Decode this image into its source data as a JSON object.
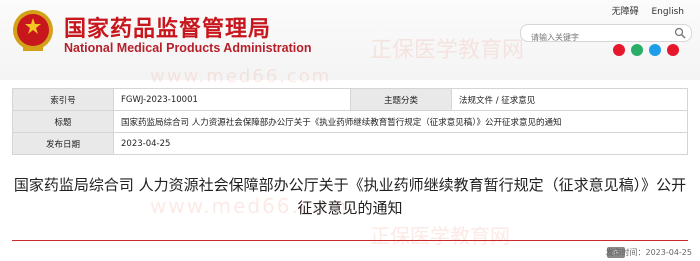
{
  "header": {
    "site_title_cn": "国家药品监督管理局",
    "site_title_en": "National Medical Products Administration",
    "top_links": [
      "无障碍",
      "English"
    ],
    "search_placeholder": "请输入关键字"
  },
  "watermark": {
    "brand": "正保医学教育网",
    "url": "www.med66.com"
  },
  "meta": {
    "index_label": "索引号",
    "index_value": "FGWJ-2023-10001",
    "subject_label": "主题分类",
    "subject_value": "法规文件 / 征求意见",
    "title_label": "标题",
    "title_value": "国家药监局综合司 人力资源社会保障部办公厅关于《执业药师继续教育暂行规定（征求意见稿）》公开征求意见的通知",
    "date_label": "发布日期",
    "date_value": "2023-04-25"
  },
  "article": {
    "title": "国家药监局综合司 人力资源社会保障部办公厅关于《执业药师继续教育暂行规定（征求意见稿）》公开征求意见的通知"
  },
  "footer": {
    "publish_time": "发布时间：2023-04-25"
  },
  "icons": [
    "emblem",
    "search-icon",
    "weibo-icon",
    "wechat-icon",
    "qq-icon",
    "print-icon"
  ],
  "colors": {
    "brand_red": "#c8161d"
  }
}
